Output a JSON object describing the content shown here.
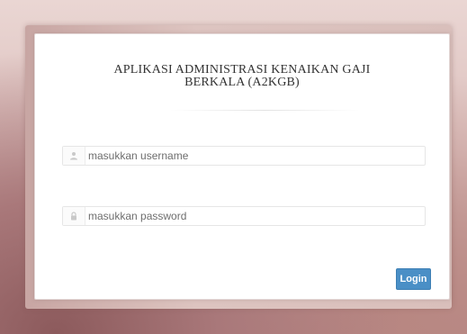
{
  "app": {
    "title_line1": "APLIKASI ADMINISTRASI KENAIKAN GAJI",
    "title_line2": "BERKALA (A2KGB)"
  },
  "login_form": {
    "username": {
      "placeholder": "masukkan username",
      "value": "",
      "icon": "user-icon"
    },
    "password": {
      "placeholder": "masukkan password",
      "value": "",
      "icon": "lock-icon"
    },
    "submit_label": "Login"
  },
  "colors": {
    "button_primary": "#4a8fc6",
    "card_background": "#ffffff",
    "page_background": "#dcc0bd"
  }
}
